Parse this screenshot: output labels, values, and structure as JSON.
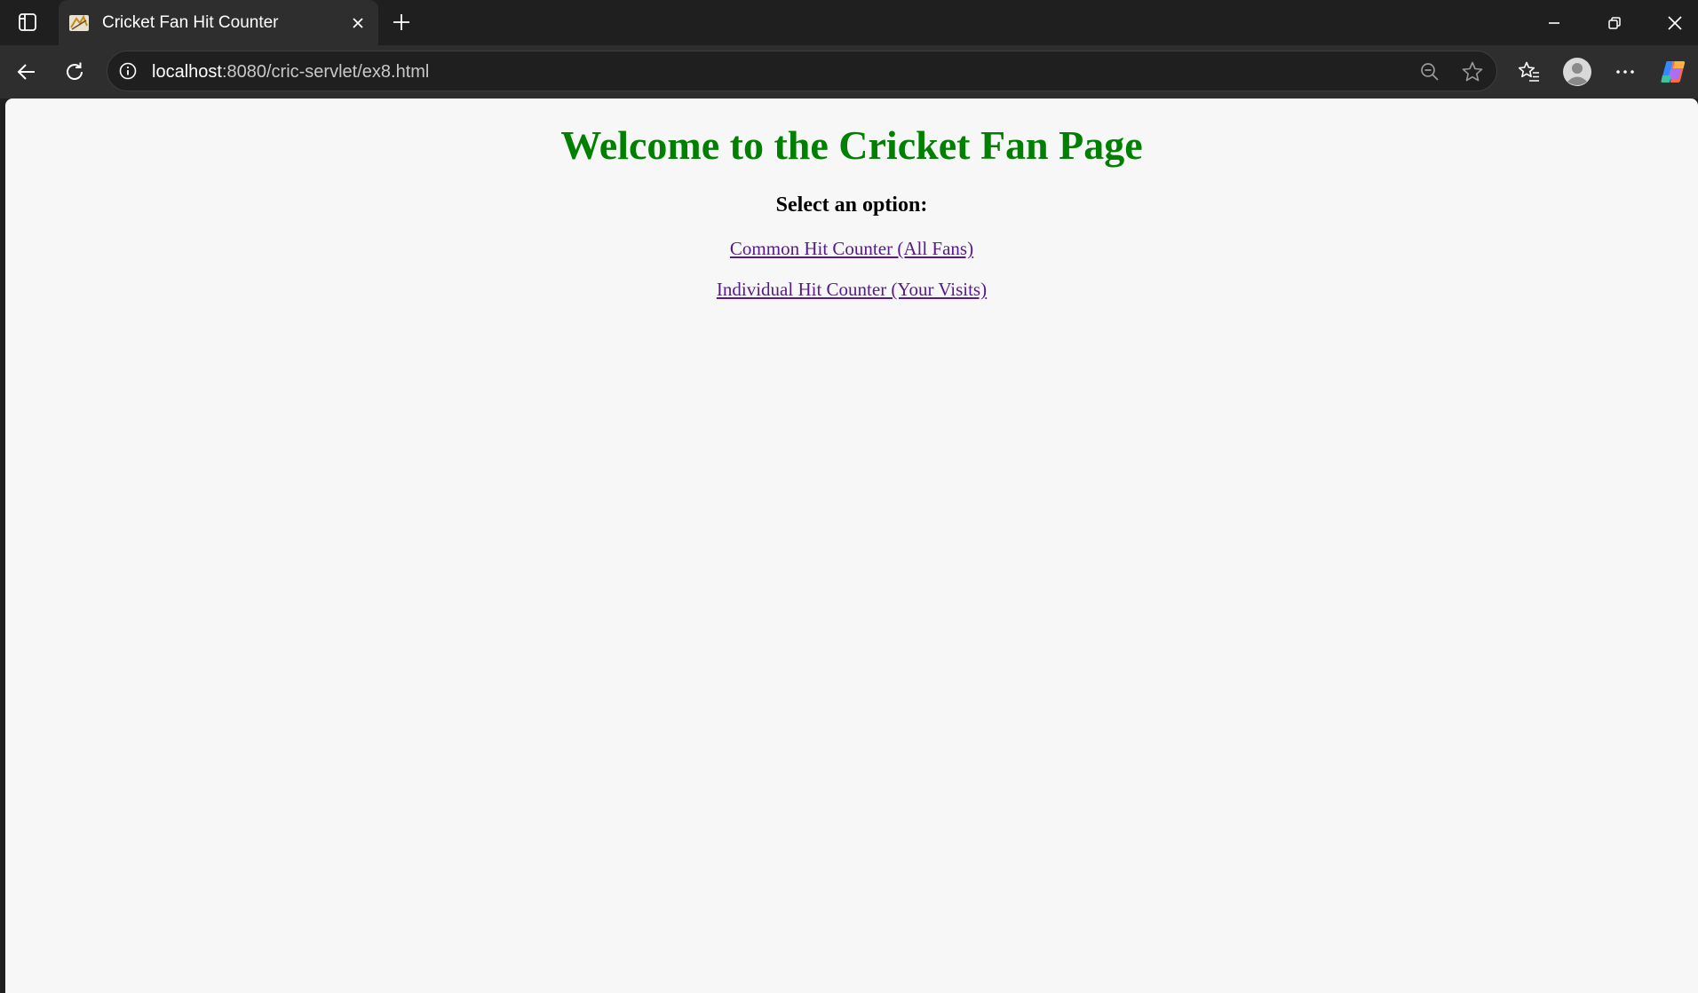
{
  "browser": {
    "tab": {
      "title": "Cricket Fan Hit Counter",
      "favicon": "tomcat-icon"
    },
    "address_bar": {
      "host": "localhost",
      "path": ":8080/cric-servlet/ex8.html"
    },
    "icons": {
      "tab_actions": "tab-actions-icon",
      "close_tab": "close-icon",
      "new_tab": "plus-icon",
      "minimize": "minimize-icon",
      "restore": "restore-icon",
      "close_window": "close-icon",
      "back": "back-arrow-icon",
      "refresh": "refresh-icon",
      "site_info": "info-icon",
      "zoom": "zoom-out-icon",
      "favorite": "star-icon",
      "favorites": "favorites-icon",
      "profile": "profile-icon",
      "more": "more-icon",
      "copilot": "copilot-icon"
    }
  },
  "page": {
    "heading": "Welcome to the Cricket Fan Page",
    "subheading": "Select an option:",
    "links": [
      {
        "label": "Common Hit Counter (All Fans)"
      },
      {
        "label": "Individual Hit Counter (Your Visits)"
      }
    ],
    "colors": {
      "heading": "#008000",
      "link_visited": "#551a8b",
      "background": "#f7f7f7"
    }
  }
}
